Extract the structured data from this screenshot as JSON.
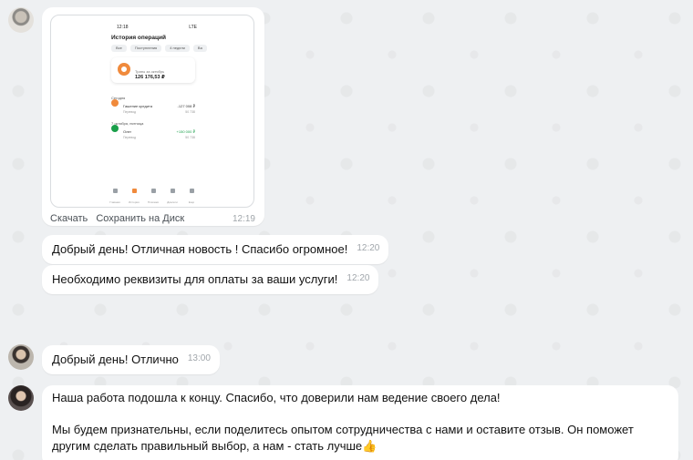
{
  "messages": {
    "image_message": {
      "download_label": "Скачать",
      "save_to_disk_label": "Сохранить на Диск",
      "time": "12:19",
      "screenshot": {
        "status_time": "12:18",
        "status_icons": "LTE",
        "title": "История операций",
        "chips": [
          "Все",
          "Поступления",
          "4 недели",
          "Ва"
        ],
        "card_caption": "Траты за октябрь",
        "card_amount": "126 176,53 ₽",
        "section_today": "Сегодня",
        "row1_name": "Гашение кредита",
        "row1_sub": "Перевод",
        "row1_amount": "-127 008 ₽",
        "row1_amount2": "50 738",
        "section_date": "7 октября, пятница",
        "row2_name": "Олег",
        "row2_sub": "Перевод",
        "row2_amount": "+150 000 ₽",
        "row2_amount2": "50 738",
        "nav": [
          "Главная",
          "История",
          "Платежи",
          "Диалоги",
          "Ещё"
        ]
      }
    },
    "m2": {
      "text": "Добрый день! Отличная новость ! Спасибо огромное!",
      "time": "12:20"
    },
    "m3": {
      "text": "Необходимо реквизиты для оплаты за ваши услуги!",
      "time": "12:20"
    },
    "m4": {
      "text": "Добрый день! Отлично",
      "time": "13:00"
    },
    "m5": {
      "para1": "Наша работа подошла к концу. Спасибо, что доверили нам ведение своего дела!",
      "para2": "Мы будем признательны, если поделитесь опытом сотрудничества с нами и оставите отзыв. Он поможет другим сделать правильный выбор, а нам - стать лучше",
      "emoji": "👍"
    }
  },
  "colors": {
    "background": "#eef0f2",
    "bubble": "#ffffff",
    "accent_orange": "#f08a3c",
    "green_amount": "#1a9f4a"
  }
}
